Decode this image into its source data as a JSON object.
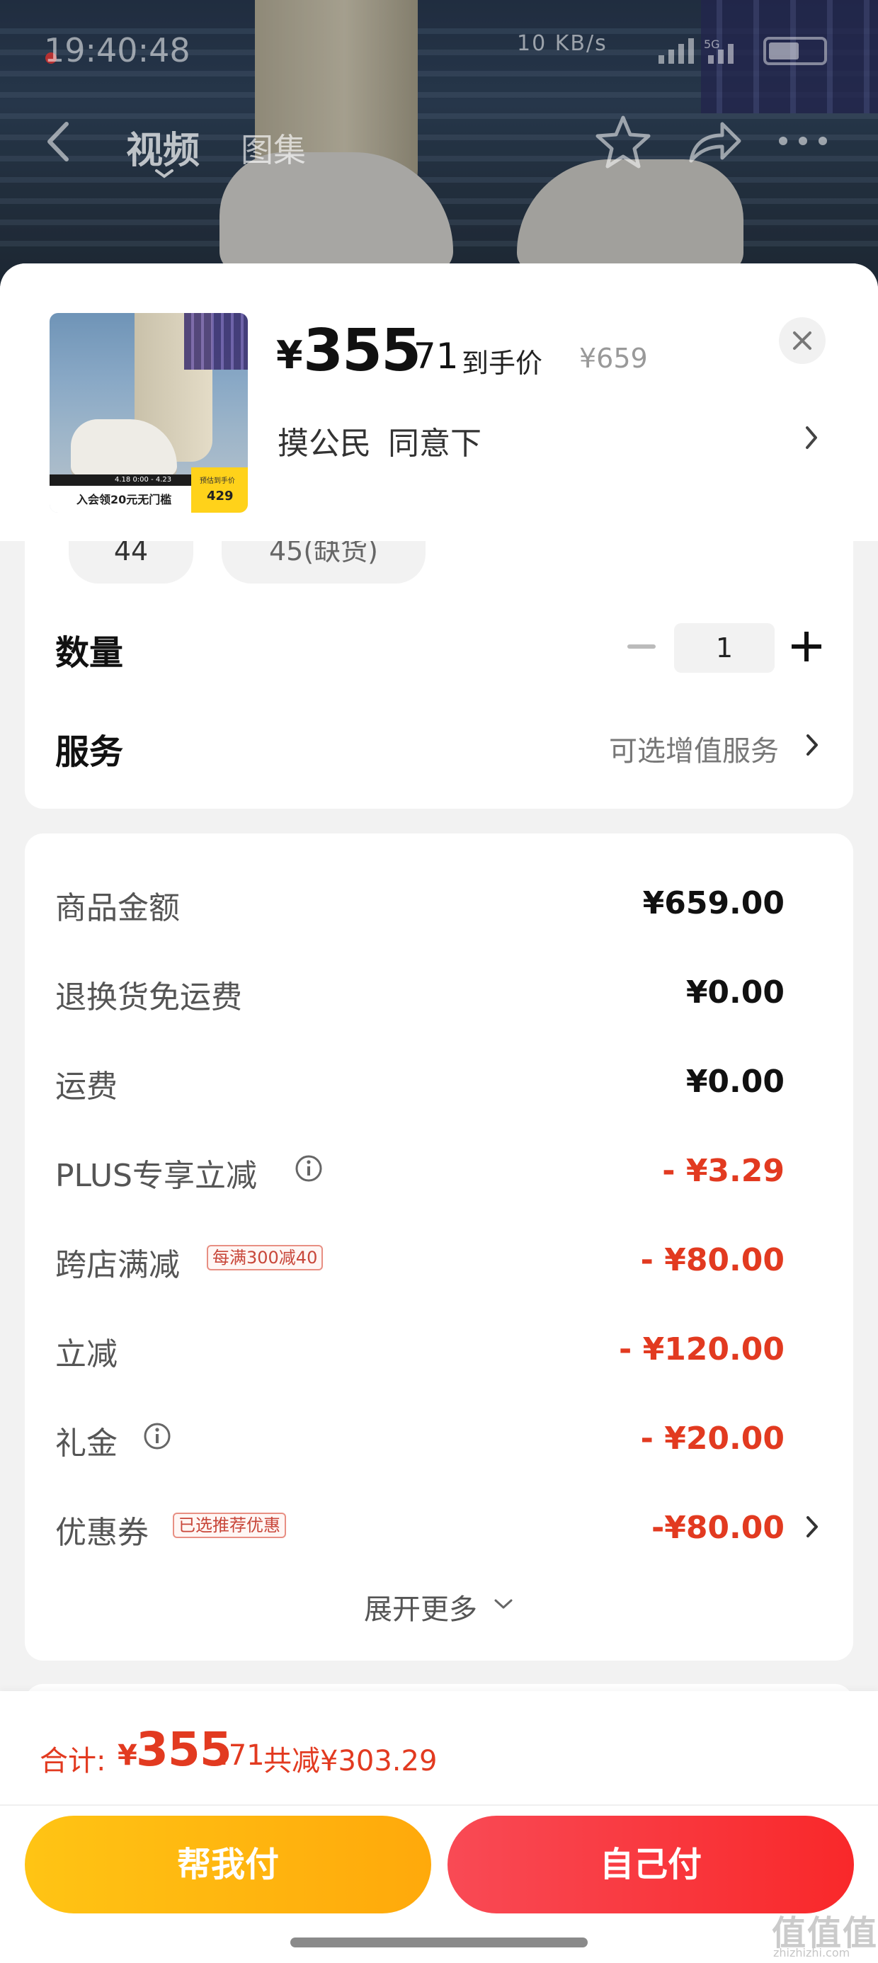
{
  "status_bar": {
    "time": "19:40:48",
    "network_speed": "10 KB/s",
    "signal": "5G"
  },
  "nav": {
    "tab_video": "视频",
    "tab_gallery": "图集"
  },
  "product": {
    "price_symbol": "¥",
    "price_integer": "355",
    "price_decimal": ".71",
    "price_label": "到手价",
    "original_price": "¥659",
    "variant": "摸公民 同意下",
    "thumbnail_banner_text": "入会领20元无门槛",
    "thumbnail_badge_label": "预估到手价",
    "thumbnail_badge_price": "429",
    "thumbnail_dates": "4.18 0:00 - 4.23 23:59"
  },
  "sizes": [
    {
      "label": "44"
    },
    {
      "label": "45(缺货)"
    }
  ],
  "quantity": {
    "label": "数量",
    "value": "1"
  },
  "service": {
    "label": "服务",
    "value": "可选增值服务"
  },
  "price_rows": [
    {
      "label": "商品金额",
      "value": "¥659.00",
      "red": false
    },
    {
      "label": "退换货免运费",
      "value": "¥0.00",
      "red": false
    },
    {
      "label": "运费",
      "value": "¥0.00",
      "red": false
    },
    {
      "label": "PLUS专享立减",
      "value": "- ¥3.29",
      "red": true,
      "icon": "info-icon"
    },
    {
      "label": "跨店满减",
      "value": "- ¥80.00",
      "red": true,
      "tag": "每满300减40"
    },
    {
      "label": "立减",
      "value": "- ¥120.00",
      "red": true
    },
    {
      "label": "礼金",
      "value": "- ¥20.00",
      "red": true,
      "icon": "info-icon"
    },
    {
      "label": "优惠券",
      "value": "-¥80.00",
      "red": true,
      "tag": "已选推荐优惠"
    }
  ],
  "expand_label": "展开更多",
  "total": {
    "label": "合计:",
    "symbol": "¥",
    "integer": "355",
    "decimal": ".71",
    "savings": "共减¥303.29"
  },
  "buttons": {
    "help_pay": "帮我付",
    "self_pay": "自己付"
  },
  "watermark": {
    "text": "值值值",
    "sub": "zhizhizhi.com"
  },
  "colors": {
    "accent_red": "#e23a20",
    "help_pay_yellow": "#ffb510",
    "self_pay_red": "#f9282a"
  }
}
